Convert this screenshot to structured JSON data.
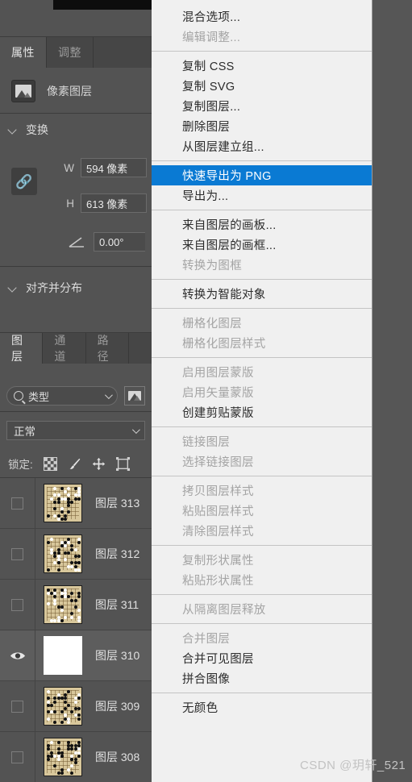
{
  "app": "Adobe Photoshop",
  "properties_panel": {
    "tabs": [
      {
        "label": "属性",
        "active": true
      },
      {
        "label": "调整",
        "active": false
      }
    ],
    "header_label": "像素图层",
    "header_icon": "pixel-layer-icon",
    "sections": [
      {
        "title": "变换"
      },
      {
        "title": "对齐并分布"
      }
    ],
    "transform": {
      "link_icon": "link-chain-icon",
      "width_label": "W",
      "width_value": "594 像素",
      "height_label": "H",
      "height_value": "613 像素",
      "angle_icon": "angle-icon",
      "angle_value": "0.00°"
    }
  },
  "layers_panel": {
    "tabs": [
      {
        "label": "图层",
        "active": true
      },
      {
        "label": "通道",
        "active": false
      },
      {
        "label": "路径",
        "active": false
      }
    ],
    "filter": {
      "icon": "search-icon",
      "value": "类型",
      "caret": "chevron-down-icon",
      "image_filter_icon": "image-filter-icon"
    },
    "blend_mode": {
      "value": "正常",
      "caret": "chevron-down-icon"
    },
    "lock": {
      "label": "锁定:",
      "icons": [
        "transparency-lock-icon",
        "brush-lock-icon",
        "move-lock-icon",
        "artboard-lock-icon"
      ]
    },
    "layers": [
      {
        "name": "图层 313",
        "visible": false,
        "selected": false,
        "thumb": "go-board"
      },
      {
        "name": "图层 312",
        "visible": false,
        "selected": false,
        "thumb": "go-board"
      },
      {
        "name": "图层 311",
        "visible": false,
        "selected": false,
        "thumb": "go-board"
      },
      {
        "name": "图层 310",
        "visible": true,
        "selected": true,
        "thumb": "white"
      },
      {
        "name": "图层 309",
        "visible": false,
        "selected": false,
        "thumb": "go-board"
      },
      {
        "name": "图层 308",
        "visible": false,
        "selected": false,
        "thumb": "go-board"
      }
    ]
  },
  "context_menu": {
    "groups": [
      {
        "items": [
          {
            "label": "混合选项...",
            "state": "normal"
          },
          {
            "label": "编辑调整...",
            "state": "disabled"
          }
        ]
      },
      {
        "items": [
          {
            "label": "复制 CSS",
            "state": "normal"
          },
          {
            "label": "复制 SVG",
            "state": "normal"
          },
          {
            "label": "复制图层...",
            "state": "normal"
          },
          {
            "label": "删除图层",
            "state": "normal"
          },
          {
            "label": "从图层建立组...",
            "state": "normal"
          }
        ]
      },
      {
        "items": [
          {
            "label": "快速导出为 PNG",
            "state": "highlighted"
          },
          {
            "label": "导出为...",
            "state": "normal"
          }
        ]
      },
      {
        "items": [
          {
            "label": "来自图层的画板...",
            "state": "normal"
          },
          {
            "label": "来自图层的画框...",
            "state": "normal"
          },
          {
            "label": "转换为图框",
            "state": "disabled"
          }
        ]
      },
      {
        "items": [
          {
            "label": "转换为智能对象",
            "state": "normal"
          }
        ]
      },
      {
        "items": [
          {
            "label": "栅格化图层",
            "state": "disabled"
          },
          {
            "label": "栅格化图层样式",
            "state": "disabled"
          }
        ]
      },
      {
        "items": [
          {
            "label": "启用图层蒙版",
            "state": "disabled"
          },
          {
            "label": "启用矢量蒙版",
            "state": "disabled"
          },
          {
            "label": "创建剪贴蒙版",
            "state": "normal"
          }
        ]
      },
      {
        "items": [
          {
            "label": "链接图层",
            "state": "disabled"
          },
          {
            "label": "选择链接图层",
            "state": "disabled"
          }
        ]
      },
      {
        "items": [
          {
            "label": "拷贝图层样式",
            "state": "disabled"
          },
          {
            "label": "粘贴图层样式",
            "state": "disabled"
          },
          {
            "label": "清除图层样式",
            "state": "disabled"
          }
        ]
      },
      {
        "items": [
          {
            "label": "复制形状属性",
            "state": "disabled"
          },
          {
            "label": "粘贴形状属性",
            "state": "disabled"
          }
        ]
      },
      {
        "items": [
          {
            "label": "从隔离图层释放",
            "state": "disabled"
          }
        ]
      },
      {
        "items": [
          {
            "label": "合并图层",
            "state": "disabled"
          },
          {
            "label": "合并可见图层",
            "state": "normal"
          },
          {
            "label": "拼合图像",
            "state": "normal"
          }
        ]
      },
      {
        "items": [
          {
            "label": "无颜色",
            "state": "normal"
          }
        ]
      }
    ]
  },
  "watermark": "CSDN @玥轩_521",
  "colors": {
    "panel_bg": "#535353",
    "tab_bg": "#464646",
    "menu_bg": "#f0f0f0",
    "highlight": "#0a7ad3",
    "text_light": "#e0e0e0",
    "text_disabled": "#a4a4a4"
  }
}
